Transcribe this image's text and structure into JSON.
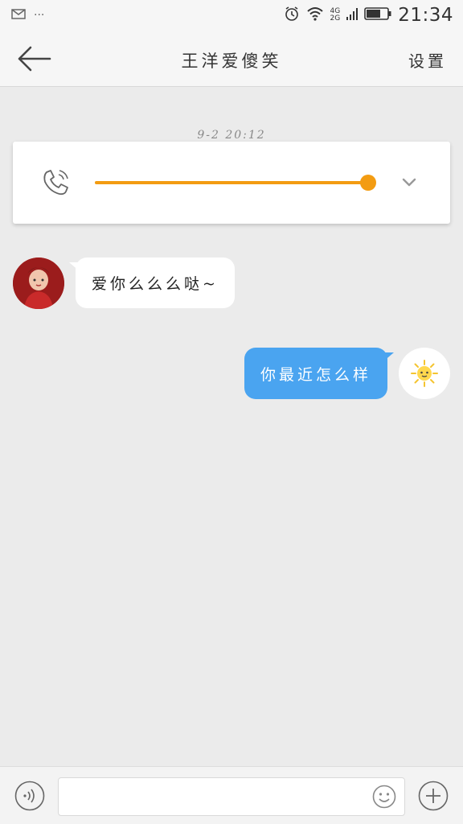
{
  "status_bar": {
    "time": "21:34",
    "network_top": "4G",
    "network_bottom": "2G",
    "dots": "···"
  },
  "header": {
    "title": "王洋爱傻笑",
    "settings_label": "设置"
  },
  "chat": {
    "timestamp": "9-2  20:12",
    "voice_message": {
      "playback_progress": 1.0
    },
    "messages": [
      {
        "direction": "incoming",
        "text": "爱你么么么哒~"
      },
      {
        "direction": "outgoing",
        "text": "你最近怎么样"
      }
    ]
  },
  "input_bar": {
    "placeholder": "",
    "value": ""
  },
  "icons": {
    "back": "arrow-left-icon",
    "call": "phone-icon",
    "expand": "chevron-down-icon",
    "voice": "voice-input-icon",
    "emoji": "smiley-icon",
    "more": "plus-icon"
  },
  "colors": {
    "accent_orange": "#f39c12",
    "outgoing_bubble": "#4aa4f0",
    "background": "#ebebeb"
  }
}
